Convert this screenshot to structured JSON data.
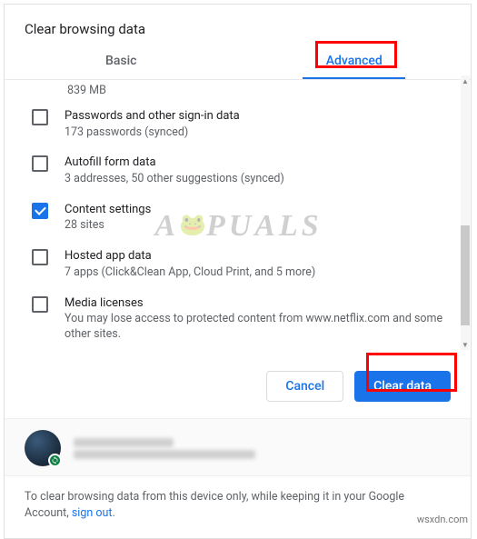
{
  "dialog": {
    "title": "Clear browsing data",
    "tabs": {
      "basic": "Basic",
      "advanced": "Advanced",
      "active_index": 1
    },
    "partial_item_sub": "839 MB",
    "items": [
      {
        "label": "Passwords and other sign-in data",
        "sub": "173 passwords (synced)",
        "checked": false
      },
      {
        "label": "Autofill form data",
        "sub": "3 addresses, 50 other suggestions (synced)",
        "checked": false
      },
      {
        "label": "Content settings",
        "sub": "28 sites",
        "checked": true
      },
      {
        "label": "Hosted app data",
        "sub": "7 apps (Click&Clean App, Cloud Print, and 5 more)",
        "checked": false
      },
      {
        "label": "Media licenses",
        "sub": "You may lose access to protected content from www.netflix.com and some other sites.",
        "checked": false
      }
    ],
    "actions": {
      "cancel": "Cancel",
      "confirm": "Clear data"
    },
    "footer": {
      "text": "To clear browsing data from this device only, while keeping it in your Google Account, ",
      "link": "sign out",
      "after": "."
    }
  },
  "watermark": "A   PUALS",
  "attribution": "wsxdn.com"
}
